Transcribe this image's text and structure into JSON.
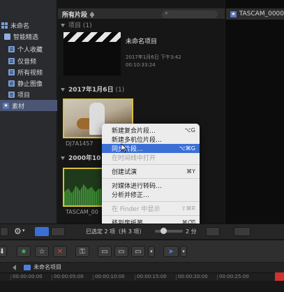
{
  "sidebar": {
    "library": "未命名",
    "smart_collections": "智能精选",
    "items": [
      "个人收藏",
      "仅音频",
      "所有视频",
      "静止图像",
      "项目"
    ],
    "event": "素材"
  },
  "browser": {
    "filter_label": "所有片段 ≑",
    "section_projects": "项目",
    "section_projects_count": "(1)",
    "project": {
      "name": "未命名项目",
      "date": "2017年1月6日 下午3:42",
      "duration": "00:10:33:24"
    },
    "section_date": "2017年1月6日",
    "section_date_count": "(1)",
    "clip1_name": "DJ7A1457",
    "section_2000": "2000年10",
    "clip2_name": "TASCAM_00"
  },
  "viewer": {
    "title": "TASCAM_0000"
  },
  "context_menu": {
    "items": [
      {
        "label": "新建复合片段…",
        "shortcut": "⌥G",
        "state": "normal"
      },
      {
        "label": "新建多机位片段…",
        "shortcut": "",
        "state": "normal"
      },
      {
        "label": "同步片段…",
        "shortcut": "⌥⌘G",
        "state": "highlighted"
      },
      {
        "label": "在时间线中打开",
        "shortcut": "",
        "state": "disabled"
      },
      {
        "label": "创建试演",
        "shortcut": "⌘Y",
        "state": "normal"
      },
      {
        "label": "对媒体进行转码…",
        "shortcut": "",
        "state": "normal"
      },
      {
        "label": "分析并修正…",
        "shortcut": "",
        "state": "normal"
      },
      {
        "label": "在 Finder 中显示",
        "shortcut": "⇧⌘R",
        "state": "disabled"
      },
      {
        "label": "移到废纸篓",
        "shortcut": "⌘⌫",
        "state": "normal"
      }
    ]
  },
  "browser_toolbar": {
    "selection_status": "已选定 2 项（共 3 项）",
    "zoom_label": "2 分"
  },
  "timeline": {
    "project_name": "未命名项目",
    "ticks": [
      "00:00:00:00",
      "00:00:05:00",
      "00:00:10:00",
      "00:00:15:00",
      "00:00:20:00",
      "00:00:25:00"
    ]
  },
  "colors": {
    "selection": "#3b6fd6",
    "clip_border": "#d8c23a",
    "sidebar_selected": "#4a5673"
  }
}
